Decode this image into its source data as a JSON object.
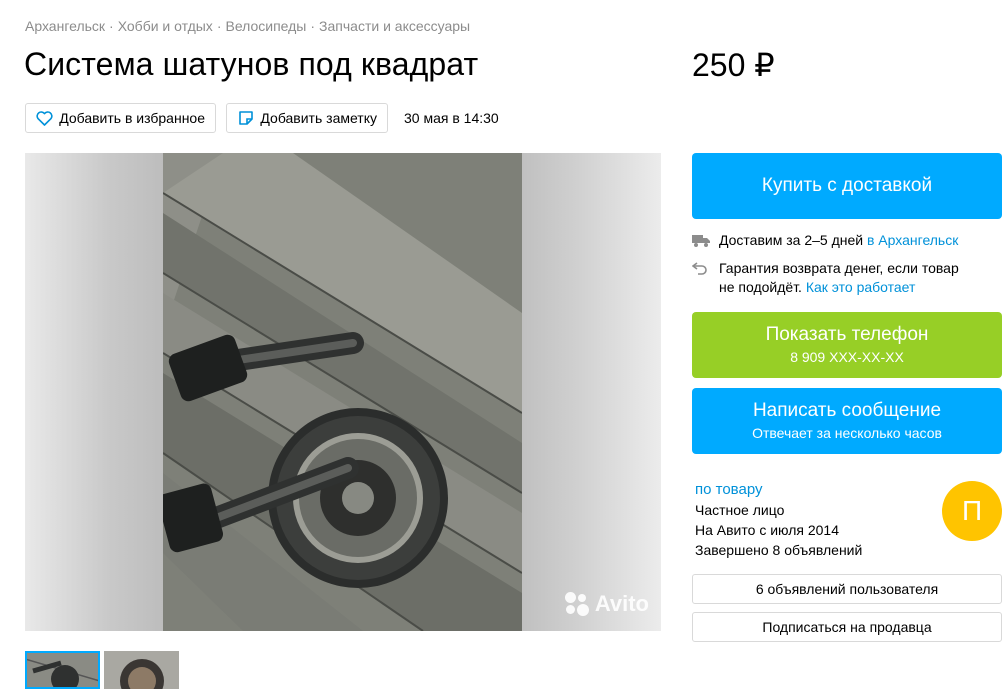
{
  "breadcrumb": [
    "Архангельск",
    "Хобби и отдых",
    "Велосипеды",
    "Запчасти и аксессуары"
  ],
  "breadcrumb_separator": "·",
  "title": "Система шатунов под квадрат",
  "price": "250 ₽",
  "actions": {
    "favorite_label": "Добавить в избранное",
    "note_label": "Добавить заметку",
    "date": "30 мая в 14:30"
  },
  "gallery": {
    "watermark": "Avito",
    "thumbnails": 2
  },
  "buy_button": {
    "label": "Купить с доставкой"
  },
  "delivery": {
    "text": "Доставим за 2–5 дней",
    "link": "в Архангельск"
  },
  "guarantee": {
    "text_line1": "Гарантия возврата денег, если товар",
    "text_line2": "не подойдёт.",
    "link": "Как это работает"
  },
  "phone_button": {
    "label": "Показать телефон",
    "number": "8 909 XXX-XX-XX"
  },
  "message_button": {
    "label": "Написать сообщение",
    "sub": "Отвечает за несколько часов"
  },
  "seller": {
    "name": "по товару",
    "type": "Частное лицо",
    "since": "На Авито с июля 2014",
    "completed": "Завершено 8 объявлений",
    "avatar_letter": "П"
  },
  "seller_ads_button": "6 объявлений пользователя",
  "subscribe_button": "Подписаться на продавца",
  "colors": {
    "accent_blue": "#00aaff",
    "accent_green": "#97cf26",
    "link": "#0091d9",
    "avatar": "#ffc400"
  }
}
